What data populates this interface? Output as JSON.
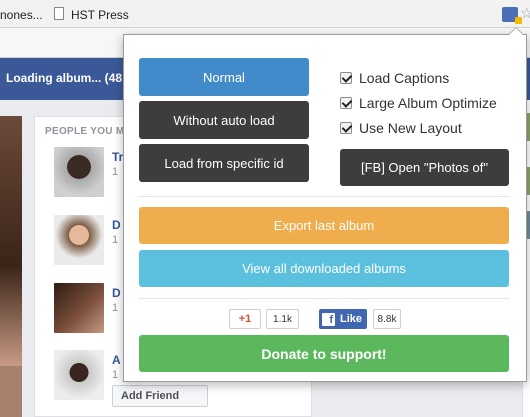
{
  "browser": {
    "bookmarks": [
      "nones...",
      "HST Press"
    ]
  },
  "facebook": {
    "status_text": "Loading album... (48",
    "section_title": "PEOPLE YOU M",
    "people": [
      {
        "name": "Tr",
        "meta": "1"
      },
      {
        "name": "D",
        "meta": "1"
      },
      {
        "name": "D",
        "meta": "1"
      },
      {
        "name": "A",
        "meta": "1"
      }
    ],
    "add_friend_label": "Add Friend"
  },
  "popup": {
    "buttons": {
      "normal": "Normal",
      "without_auto_load": "Without auto load",
      "load_specific_id": "Load from specific id",
      "open_photos_of": "[FB] Open \"Photos of\"",
      "export_last_album": "Export last album",
      "view_downloaded": "View all downloaded albums",
      "donate": "Donate to support!"
    },
    "options": [
      {
        "label": "Load Captions",
        "checked": true
      },
      {
        "label": "Large Album Optimize",
        "checked": true
      },
      {
        "label": "Use New Layout",
        "checked": true
      }
    ],
    "social": {
      "gplus_label": "+1",
      "gplus_count": "1.1k",
      "fb_like_label": "Like",
      "fb_count": "8.8k"
    }
  },
  "colors": {
    "primary_blue": "#428bca",
    "dark": "#3d3d3d",
    "orange": "#f0ad4e",
    "info_blue": "#5bc0de",
    "green": "#5cb85c",
    "facebook_blue": "#3b5998"
  }
}
